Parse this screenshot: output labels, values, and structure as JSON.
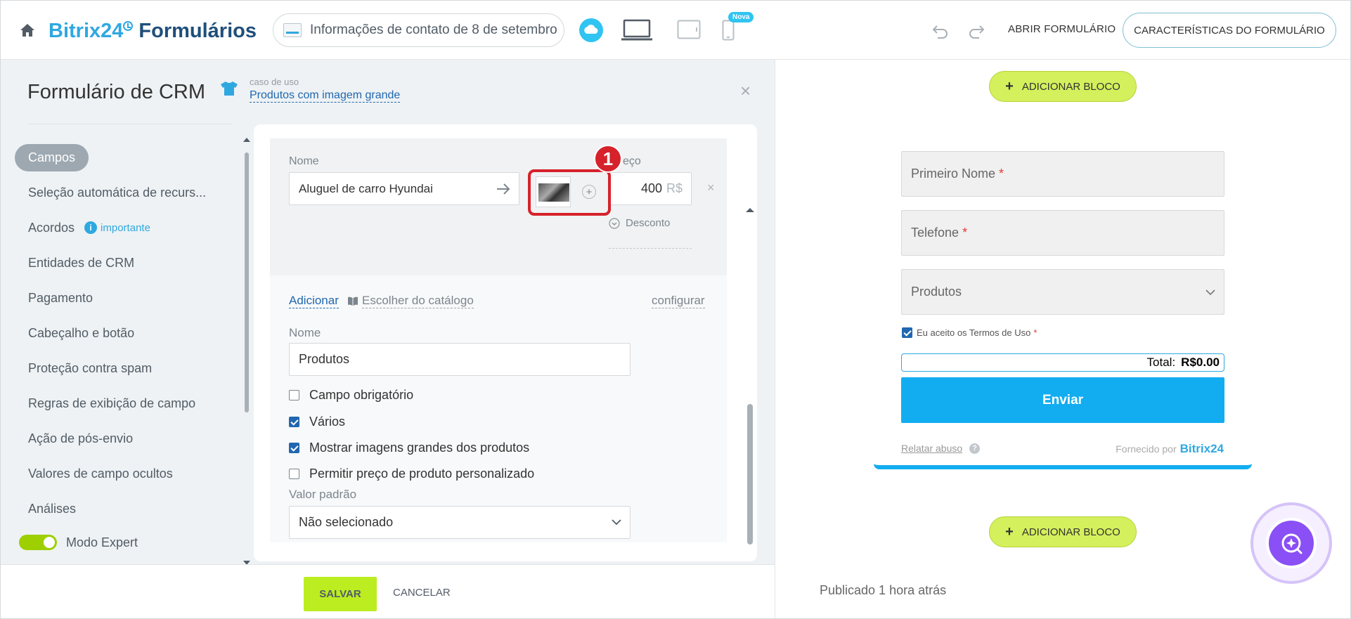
{
  "header": {
    "logo_brand": "Bitrix24",
    "logo_product": "Formulários",
    "form_name": "Informações de contato de 8 de setembro",
    "nova_badge": "Nova",
    "open_form": "ABRIR FORMULÁRIO",
    "form_features": "CARACTERÍSTICAS DO FORMULÁRIO"
  },
  "panel": {
    "title": "Formulário de CRM",
    "use_case_label": "caso de uso",
    "use_case_value": "Produtos com imagem grande",
    "close": "×"
  },
  "sidebar": {
    "items": [
      {
        "label": "Campos",
        "active": true
      },
      {
        "label": "Seleção automática de recurs..."
      },
      {
        "label": "Acordos",
        "badge": "importante"
      },
      {
        "label": "Entidades de CRM"
      },
      {
        "label": "Pagamento"
      },
      {
        "label": "Cabeçalho e botão"
      },
      {
        "label": "Proteção contra spam"
      },
      {
        "label": "Regras de exibição de campo"
      },
      {
        "label": "Ação de pós-envio"
      },
      {
        "label": "Valores de campo ocultos"
      },
      {
        "label": "Análises"
      }
    ],
    "expert_mode": "Modo Expert"
  },
  "field_settings": {
    "product_name_label": "Nome",
    "product_name_value": "Aluguel de carro Hyundai",
    "price_label": "eço",
    "price_value": "400",
    "currency": "R$",
    "discount": "Desconto",
    "annotation_number": "1",
    "add_link": "Adicionar",
    "catalog_link": "Escolher do catálogo",
    "configure_link": "configurar",
    "field_name_label": "Nome",
    "field_name_value": "Produtos",
    "options": [
      {
        "label": "Campo obrigatório",
        "checked": false
      },
      {
        "label": "Vários",
        "checked": true
      },
      {
        "label": "Mostrar imagens grandes dos produtos",
        "checked": true
      },
      {
        "label": "Permitir preço de produto personalizado",
        "checked": false
      }
    ],
    "default_label": "Valor padrão",
    "default_value": "Não selecionado"
  },
  "footer": {
    "save": "SALVAR",
    "cancel": "CANCELAR"
  },
  "preview": {
    "add_block": "ADICIONAR BLOCO",
    "first_name": "Primeiro Nome",
    "phone": "Telefone",
    "required_mark": "*",
    "products": "Produtos",
    "terms": "Eu aceito os Termos de Uso",
    "total_label": "Total:",
    "total_value": "R$0.00",
    "submit": "Enviar",
    "report_abuse": "Relatar abuso",
    "help": "?",
    "powered_by": "Fornecido por",
    "powered_brand": "Bitrix24",
    "published": "Publicado 1 hora atrás"
  },
  "colors": {
    "accent_blue": "#2fa8e0",
    "save_green": "#bbed21",
    "submit_blue": "#12adf0",
    "annotation_red": "#d6222b",
    "assistant_purple": "#8a4ff5"
  }
}
